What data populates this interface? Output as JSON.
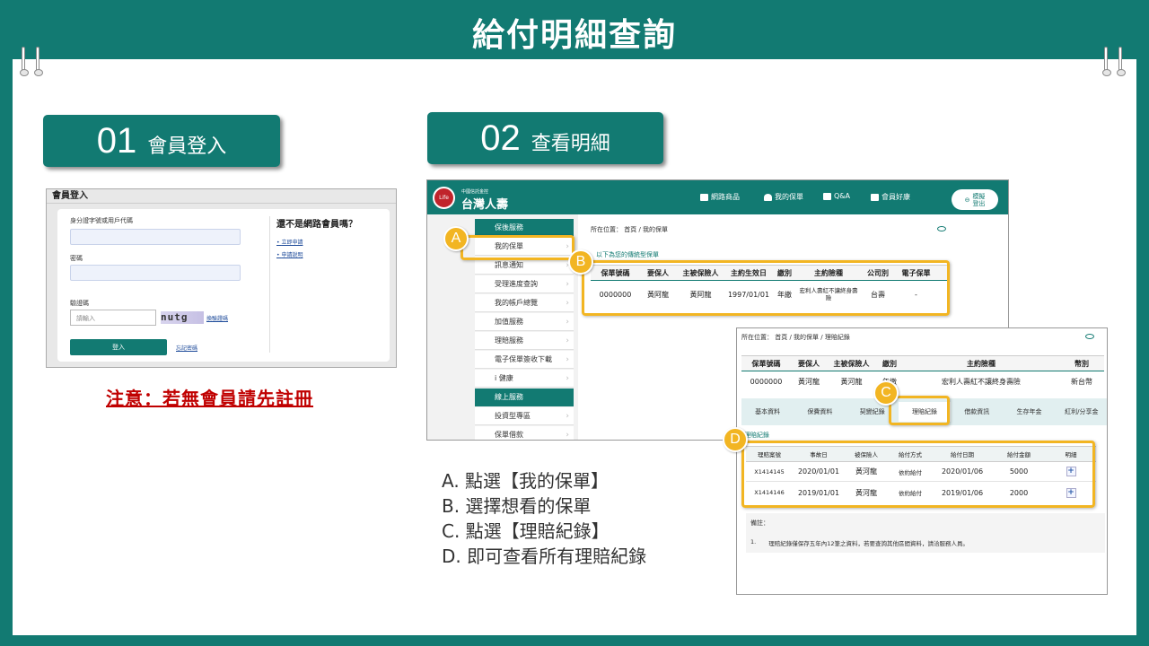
{
  "page": {
    "title": "給付明細查詢"
  },
  "step1": {
    "num": "01",
    "label": "會員登入"
  },
  "step2": {
    "num": "02",
    "label": "查看明細"
  },
  "login": {
    "heading": "會員登入",
    "id_label": "身分證字號或用戶代碼",
    "password_label": "密碼",
    "captcha_label": "驗證碼",
    "captcha_placeholder": "請輸入",
    "captcha_image_text": "nutg",
    "refresh_captcha": "換驗證碼",
    "login_button": "登入",
    "forgot_password": "忘記密碼",
    "register_heading": "還不是網路會員嗎？",
    "register_link": "立即申請",
    "register_guide": "申請說明"
  },
  "notice": "注意：若無會員請先註冊",
  "portal": {
    "brand_sub": "中國信託金控",
    "brand": "台灣人壽",
    "logo_text": "Life",
    "nav": [
      "網路商品",
      "我的保單",
      "Q&A",
      "會員好康"
    ],
    "logout": [
      "模擬",
      "登出"
    ],
    "sidebar": [
      "保後服務",
      "我的保單",
      "訊息通知",
      "受理進度查詢",
      "我的帳戶總覽",
      "加值服務",
      "理賠服務",
      "電子保單簽收下載",
      "i 健康",
      "線上服務",
      "投資型專區",
      "保單借款"
    ],
    "breadcrumb": "所在位置： 首頁 / 我的保單",
    "section": "以下為您的傳統型保單",
    "policy_headers": [
      "保單號碼",
      "要保人",
      "主被保險人",
      "主約生效日",
      "繳別",
      "主約險種",
      "公司別",
      "電子保單"
    ],
    "policy_row": [
      "0000000",
      "黃阿龍",
      "黃阿龍",
      "1997/01/01",
      "年繳",
      "宏利人壽紅不讓終身壽險",
      "台壽",
      "-"
    ]
  },
  "claims": {
    "breadcrumb": "所在位置： 首頁 / 我的保單 / 理賠紀錄",
    "policy_headers": [
      "保單號碼",
      "要保人",
      "主被保險人",
      "繳別",
      "主約險種",
      "幣別"
    ],
    "policy_row": [
      "0000000",
      "黃河龍",
      "黃河龍",
      "年繳",
      "宏利人壽紅不讓終身壽險",
      "新台幣"
    ],
    "tabs": [
      "基本資料",
      "保費資料",
      "契變紀錄",
      "理賠紀錄",
      "借款資訊",
      "生存年金",
      "紅利/分享金"
    ],
    "section": "理賠紀錄",
    "headers": [
      "理賠案號",
      "事故日",
      "被保險人",
      "給付方式",
      "給付日期",
      "給付金額",
      "明細"
    ],
    "rows": [
      [
        "X1414145",
        "2020/01/01",
        "黃河龍",
        "依約給付",
        "2020/01/06",
        "5000",
        "+"
      ],
      [
        "X1414146",
        "2019/01/01",
        "黃河龍",
        "依約給付",
        "2019/01/06",
        "2000",
        "+"
      ]
    ],
    "note_title": "備註：",
    "note_index": "1.",
    "note_text": "理賠紀錄僅保存五年內12筆之資料，若要查詢其他區間資料，請洽服務人員。"
  },
  "badges": [
    "A",
    "B",
    "C",
    "D"
  ],
  "instructions": [
    "A. 點選【我的保單】",
    "B. 選擇想看的保單",
    "C. 點選【理賠紀錄】",
    "D. 即可查看所有理賠紀錄"
  ],
  "colors": {
    "brand": "#127a72",
    "highlight": "#f2b522",
    "notice": "#c00000"
  }
}
